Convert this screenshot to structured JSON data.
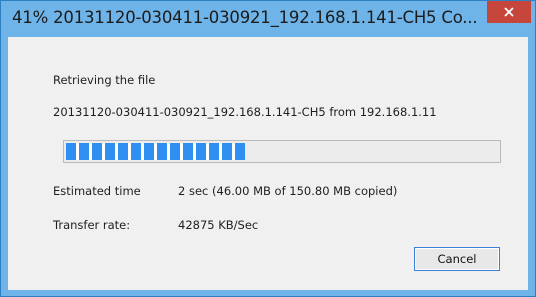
{
  "window": {
    "title": "41% 20131120-030411-030921_192.168.1.141-CH5 Co...",
    "close_label": "✕"
  },
  "dialog": {
    "heading": "Retrieving the file",
    "file_line": "20131120-030411-030921_192.168.1.141-CH5 from 192.168.1.11",
    "progress_fraction": 0.41,
    "estimated_label": "Estimated time",
    "estimated_value": "2 sec (46.00 MB of 150.80 MB copied)",
    "rate_label": "Transfer rate:",
    "rate_value": "42875 KB/Sec",
    "cancel_label": "Cancel"
  },
  "colors": {
    "titlebar": "#6fb4e8",
    "close_button": "#c7463b",
    "progress_fill": "#2f8ff0",
    "content_bg": "#f0f0f0"
  },
  "icons": {
    "close": "close-icon"
  }
}
